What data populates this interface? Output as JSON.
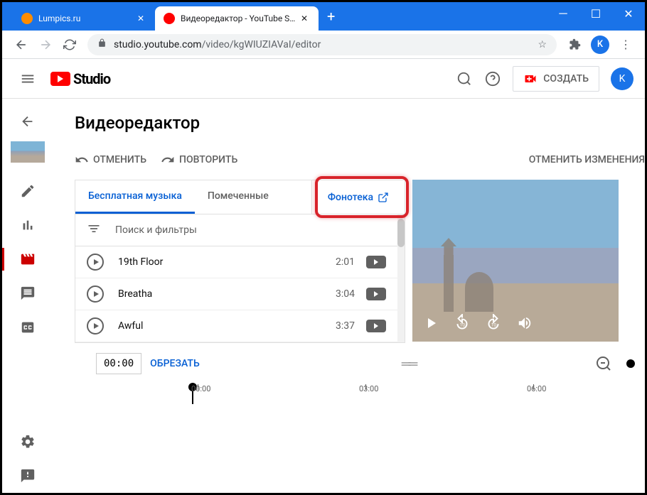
{
  "window": {
    "tabs": [
      {
        "title": "Lumpics.ru",
        "favicon": "#ff8c00"
      },
      {
        "title": "Видеоредактор - YouTube Studio",
        "favicon": "#ff0000"
      }
    ]
  },
  "addressbar": {
    "domain": "studio.youtube.com",
    "path": "/video/kgWIUZIAVaI/editor"
  },
  "header": {
    "logo": "Studio",
    "create": "СОЗДАТЬ",
    "user_initial": "K"
  },
  "page": {
    "title": "Видеоредактор",
    "undo": "ОТМЕНИТЬ",
    "redo": "ПОВТОРИТЬ",
    "discard": "ОТМЕНИТЬ ИЗМЕНЕНИЯ"
  },
  "tabs": {
    "free_music": "Бесплатная музыка",
    "marked": "Помеченные",
    "library": "Фонотека"
  },
  "search": {
    "placeholder": "Поиск и фильтры"
  },
  "tracks": [
    {
      "name": "19th Floor",
      "duration": "2:01"
    },
    {
      "name": "Breatha",
      "duration": "3:04"
    },
    {
      "name": "Awful",
      "duration": "3:37"
    }
  ],
  "timeline": {
    "time": "00:00",
    "trim": "ОБРЕЗАТЬ",
    "marks": [
      "00:00",
      "03:00",
      "06:00"
    ]
  }
}
